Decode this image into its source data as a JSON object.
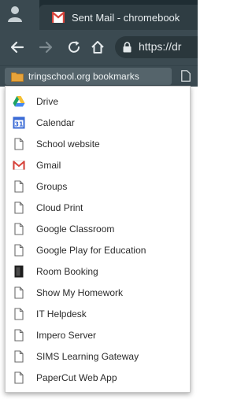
{
  "browser": {
    "tab": {
      "title": "Sent Mail - chromebook"
    },
    "omnibox": {
      "url": "https://dr"
    },
    "bookmarks_bar": {
      "folder_label": "tringschool.org bookmarks",
      "folder_icon": "folder-icon",
      "page_icon": "page-icon"
    }
  },
  "colors": {
    "tabstrip": "#1f2d33",
    "toolbar": "#3b4a51",
    "folder_highlight": "#55646b",
    "gmail_red": "#d8423a",
    "calendar_blue": "#3b6bd6"
  },
  "menu": {
    "items": [
      {
        "label": "Drive",
        "icon": "drive-icon"
      },
      {
        "label": "Calendar",
        "icon": "calendar-icon"
      },
      {
        "label": "School website",
        "icon": "page-icon"
      },
      {
        "label": "Gmail",
        "icon": "gmail-icon"
      },
      {
        "label": "Groups",
        "icon": "page-icon"
      },
      {
        "label": "Cloud Print",
        "icon": "page-icon"
      },
      {
        "label": "Google Classroom",
        "icon": "page-icon"
      },
      {
        "label": "Google Play for Education",
        "icon": "page-icon"
      },
      {
        "label": "Room Booking",
        "icon": "room-booking-icon"
      },
      {
        "label": "Show My Homework",
        "icon": "page-icon"
      },
      {
        "label": "IT Helpdesk",
        "icon": "page-icon"
      },
      {
        "label": "Impero Server",
        "icon": "page-icon"
      },
      {
        "label": "SIMS Learning Gateway",
        "icon": "page-icon"
      },
      {
        "label": "PaperCut Web App",
        "icon": "page-icon"
      }
    ]
  }
}
